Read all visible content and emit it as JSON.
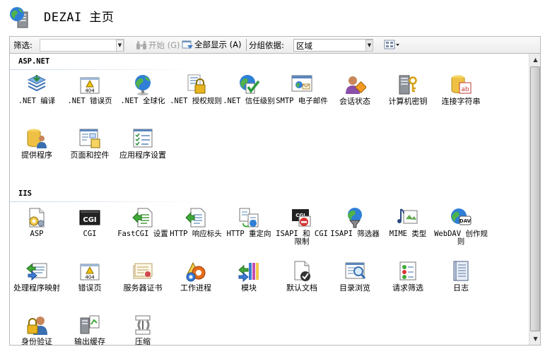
{
  "header": {
    "title": "DEZAI 主页",
    "icon": "server-globe-icon"
  },
  "toolbar": {
    "filter_label": "筛选:",
    "filter_value": "",
    "start_label": "开始 (G)",
    "show_all_label": "全部显示 (A)",
    "group_by_label": "分组依据:",
    "group_by_value": "区域"
  },
  "groups": [
    {
      "name": "ASP.NET",
      "items": [
        {
          "label": ".NET 编译",
          "icon": "dotnet-compile-icon"
        },
        {
          "label": ".NET 错误页",
          "icon": "error-404-icon"
        },
        {
          "label": ".NET 全球化",
          "icon": "globe-icon"
        },
        {
          "label": ".NET 授权规则",
          "icon": "authorization-lock-icon"
        },
        {
          "label": ".NET 信任级别",
          "icon": "trust-level-icon"
        },
        {
          "label": "SMTP 电子邮件",
          "icon": "smtp-email-icon"
        },
        {
          "label": "会话状态",
          "icon": "session-state-icon"
        },
        {
          "label": "计算机密钥",
          "icon": "machine-key-icon"
        },
        {
          "label": "连接字符串",
          "icon": "connection-string-icon"
        },
        {
          "label": "提供程序",
          "icon": "providers-icon"
        },
        {
          "label": "页面和控件",
          "icon": "pages-controls-icon"
        },
        {
          "label": "应用程序设置",
          "icon": "app-settings-icon"
        }
      ]
    },
    {
      "name": "IIS",
      "items": [
        {
          "label": "ASP",
          "icon": "asp-icon"
        },
        {
          "label": "CGI",
          "icon": "cgi-icon"
        },
        {
          "label": "FastCGI 设置",
          "icon": "fastcgi-icon"
        },
        {
          "label": "HTTP 响应标头",
          "icon": "http-headers-icon"
        },
        {
          "label": "HTTP 重定向",
          "icon": "http-redirect-icon"
        },
        {
          "label": "ISAPI 和 CGI 限制",
          "icon": "isapi-cgi-icon"
        },
        {
          "label": "ISAPI 筛选器",
          "icon": "isapi-filter-icon"
        },
        {
          "label": "MIME 类型",
          "icon": "mime-types-icon"
        },
        {
          "label": "WebDAV 创作规则",
          "icon": "webdav-icon"
        },
        {
          "label": "处理程序映射",
          "icon": "handler-mappings-icon"
        },
        {
          "label": "错误页",
          "icon": "error-pages-icon"
        },
        {
          "label": "服务器证书",
          "icon": "server-certificates-icon"
        },
        {
          "label": "工作进程",
          "icon": "worker-processes-icon"
        },
        {
          "label": "模块",
          "icon": "modules-icon"
        },
        {
          "label": "默认文档",
          "icon": "default-document-icon"
        },
        {
          "label": "目录浏览",
          "icon": "directory-browsing-icon"
        },
        {
          "label": "请求筛选",
          "icon": "request-filtering-icon"
        },
        {
          "label": "日志",
          "icon": "logging-icon"
        },
        {
          "label": "身份验证",
          "icon": "authentication-icon"
        },
        {
          "label": "输出缓存",
          "icon": "output-caching-icon"
        },
        {
          "label": "压缩",
          "icon": "compression-icon"
        }
      ]
    }
  ],
  "colors": {
    "accent": "#3a7bd5",
    "warning": "#f2c200",
    "border": "#b9b9b9"
  }
}
